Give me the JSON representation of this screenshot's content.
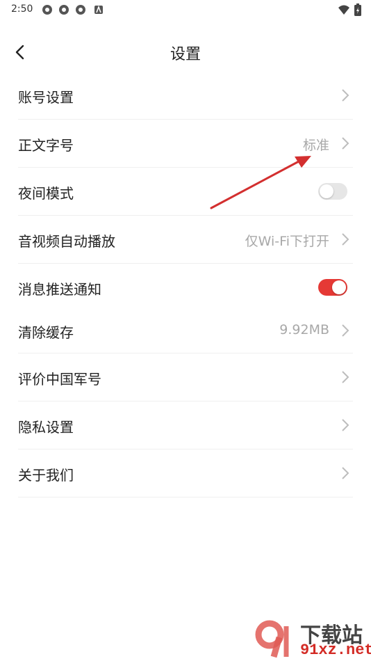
{
  "status_bar": {
    "time": "2:50"
  },
  "header": {
    "title": "设置"
  },
  "settings": [
    {
      "label": "账号设置",
      "value": "",
      "type": "chevron"
    },
    {
      "label": "正文字号",
      "value": "标准",
      "type": "chevron"
    },
    {
      "label": "夜间模式",
      "value": "",
      "type": "toggle",
      "on": false
    },
    {
      "label": "音视频自动播放",
      "value": "仅Wi-Fi下打开",
      "type": "chevron"
    },
    {
      "label": "消息推送通知",
      "value": "",
      "type": "toggle",
      "on": true
    },
    {
      "label": "清除缓存",
      "value": "9.92MB",
      "type": "chevron"
    },
    {
      "label": "评价中国军号",
      "value": "",
      "type": "chevron"
    },
    {
      "label": "隐私设置",
      "value": "",
      "type": "chevron"
    },
    {
      "label": "关于我们",
      "value": "",
      "type": "chevron"
    }
  ],
  "watermark": {
    "line1": "下载站",
    "line2": "91xz.net"
  },
  "colors": {
    "accent": "#e53935",
    "toggle_off": "#e6e6e6",
    "annotation_arrow": "#d32f2f"
  }
}
